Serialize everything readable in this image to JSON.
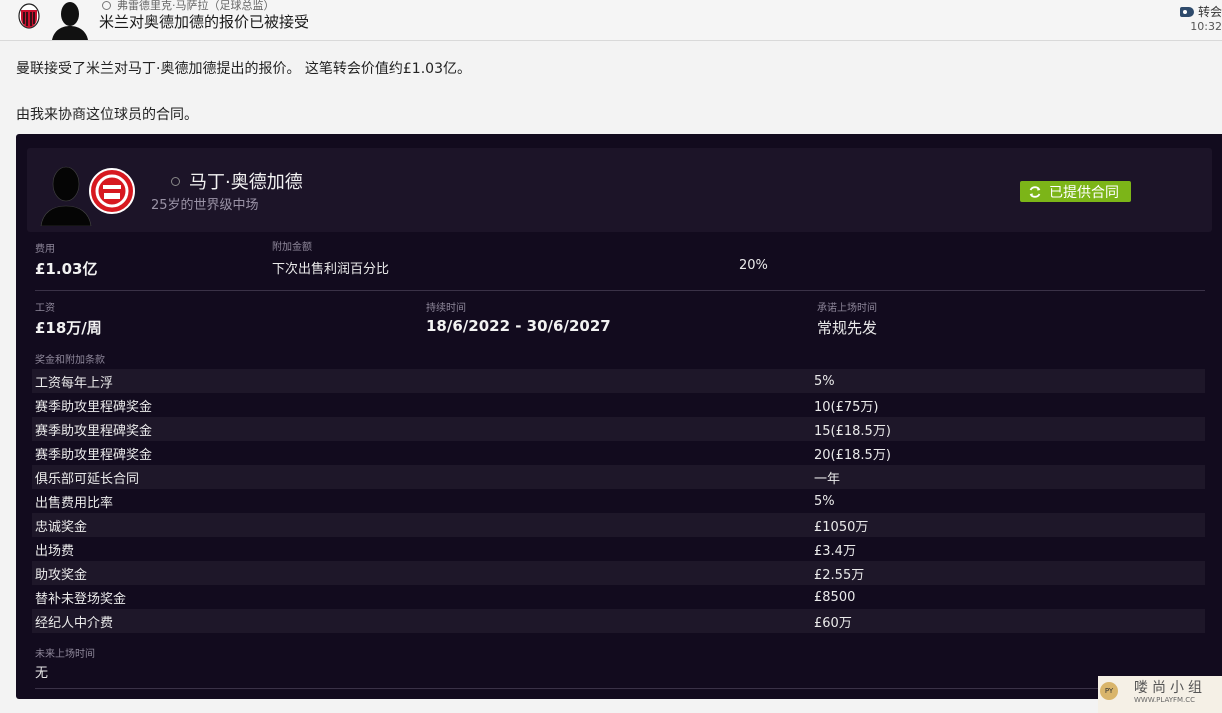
{
  "header": {
    "sender_name": "弗雷德里克·马萨拉（足球总监）",
    "subject": "米兰对奥德加德的报价已被接受",
    "tag_label": "转会",
    "time": "10:32"
  },
  "message": {
    "line1": "曼联接受了米兰对马丁·奥德加德提出的报价。 这笔转会价值约£1.03亿。",
    "line2": "由我来协商这位球员的合同。"
  },
  "player": {
    "name": "马丁·奥德加德",
    "description": "25岁的世界级中场",
    "status_label": "已提供合同",
    "status_color": "#7cb518"
  },
  "fee": {
    "label": "费用",
    "value": "£1.03亿"
  },
  "addon": {
    "label": "附加金额",
    "name": "下次出售利润百分比",
    "value": "20%"
  },
  "wage": {
    "label": "工资",
    "value": "£18万/周"
  },
  "duration": {
    "label": "持续时间",
    "value": "18/6/2022 - 30/6/2027"
  },
  "playing_time": {
    "label": "承诺上场时间",
    "value": "常规先发"
  },
  "clauses": {
    "label": "奖金和附加条款",
    "rows": [
      {
        "name": "工资每年上浮",
        "value": "5%"
      },
      {
        "name": "赛季助攻里程碑奖金",
        "value": "10(£75万)"
      },
      {
        "name": "赛季助攻里程碑奖金",
        "value": "15(£18.5万)"
      },
      {
        "name": "赛季助攻里程碑奖金",
        "value": "20(£18.5万)"
      },
      {
        "name": "俱乐部可延长合同",
        "value": "一年"
      },
      {
        "name": "出售费用比率",
        "value": "5%"
      },
      {
        "name": "忠诚奖金",
        "value": "£1050万"
      },
      {
        "name": "出场费",
        "value": "£3.4万"
      },
      {
        "name": "助攻奖金",
        "value": "£2.55万"
      },
      {
        "name": "替补未登场奖金",
        "value": "£8500"
      },
      {
        "name": "经纪人中介费",
        "value": "£60万"
      }
    ]
  },
  "future_time": {
    "label": "未来上场时间",
    "value": "无"
  },
  "watermark": {
    "badge": "PY",
    "text": "喽尚小组",
    "sub": "WWW.PLAYFM.CC"
  }
}
